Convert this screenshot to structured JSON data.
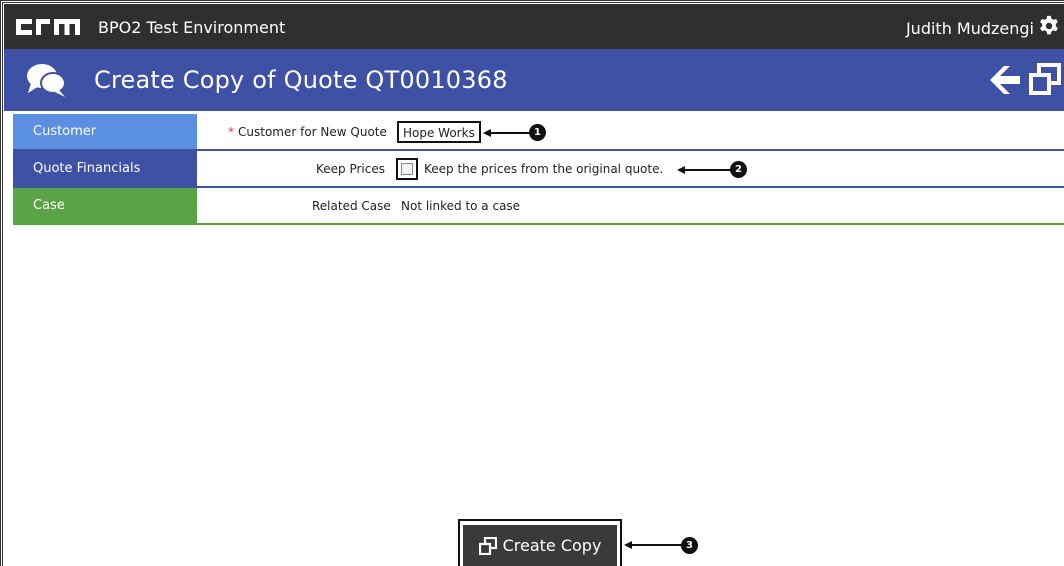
{
  "app": {
    "logo_text": "CRM",
    "environment": "BPO2 Test Environment",
    "user": "Judith Mudzengi"
  },
  "page": {
    "title": "Create Copy of Quote QT0010368"
  },
  "form": {
    "tabs": {
      "customer": "Customer",
      "financials": "Quote Financials",
      "case": "Case"
    },
    "customer_label": "Customer for New Quote",
    "customer_required_marker": "*",
    "customer_value": "Hope Works",
    "keep_prices_label": "Keep Prices",
    "keep_prices_checked": false,
    "keep_prices_hint": "Keep the prices from the original quote.",
    "related_case_label": "Related Case",
    "related_case_value": "Not linked to a case"
  },
  "actions": {
    "create_copy_label": "Create Copy"
  },
  "callouts": {
    "one": "1",
    "two": "2",
    "three": "3"
  },
  "colors": {
    "topbar": "#2f2f2f",
    "header": "#3f51a5",
    "tab_customer": "#5b8fe0",
    "tab_case": "#5aa346",
    "required": "#e53935"
  }
}
